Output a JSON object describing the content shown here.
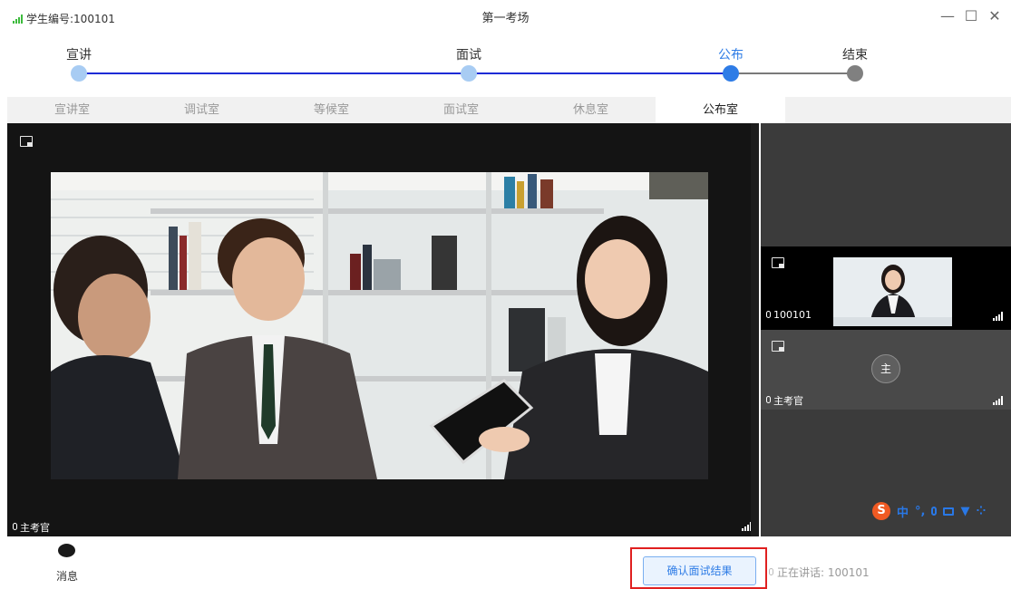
{
  "window": {
    "student_id": "学生编号:100101",
    "title": "第一考场"
  },
  "progress": {
    "stages": [
      {
        "label": "宣讲",
        "state": "done"
      },
      {
        "label": "面试",
        "state": "done"
      },
      {
        "label": "公布",
        "state": "current"
      },
      {
        "label": "结束",
        "state": "pending"
      }
    ]
  },
  "tabs": [
    {
      "label": "宣讲室",
      "active": false
    },
    {
      "label": "调试室",
      "active": false
    },
    {
      "label": "等候室",
      "active": false
    },
    {
      "label": "面试室",
      "active": false
    },
    {
      "label": "休息室",
      "active": false
    },
    {
      "label": "公布室",
      "active": true
    }
  ],
  "main_video": {
    "speaker_label": "主考官"
  },
  "side_panel": {
    "tiles": [
      {
        "label": "100101"
      },
      {
        "label": "主考官",
        "avatar_text": "主"
      }
    ],
    "ime": {
      "logo": "S",
      "lang": "中",
      "punct": "°,"
    }
  },
  "bottom": {
    "message_label": "消息",
    "confirm_button": "确认面试结果",
    "speaking_status": "正在讲话: 100101"
  },
  "colors": {
    "accent": "#2e7ce6",
    "track_done": "#1d2bd6",
    "highlight": "#e02020"
  }
}
